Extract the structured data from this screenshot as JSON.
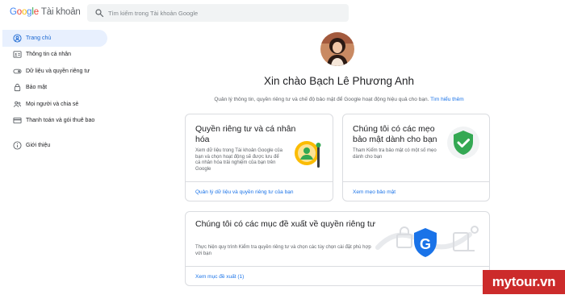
{
  "header": {
    "logo_word": "Google",
    "logo_suffix": "Tài khoản",
    "search_placeholder": "Tìm kiếm trong Tài khoản Google"
  },
  "sidebar": {
    "items": [
      {
        "label": "Trang chủ",
        "icon": "person-circle-icon",
        "active": true
      },
      {
        "label": "Thông tin cá nhân",
        "icon": "id-card-icon"
      },
      {
        "label": "Dữ liệu và quyền riêng tư",
        "icon": "toggle-icon"
      },
      {
        "label": "Bảo mật",
        "icon": "lock-icon"
      },
      {
        "label": "Mọi người và chia sẻ",
        "icon": "people-icon"
      },
      {
        "label": "Thanh toán và gói thuê bao",
        "icon": "credit-card-icon"
      },
      {
        "label": "Giới thiệu",
        "icon": "info-icon"
      }
    ]
  },
  "main": {
    "greeting": "Xin chào Bạch Lê Phương Anh",
    "subtitle": "Quản lý thông tin, quyền riêng tư và chế độ bảo mật để Google hoạt động hiệu quả cho bạn.",
    "learn_more": "Tìm hiểu thêm",
    "cards": [
      {
        "title": "Quyền riêng tư và cá nhân hóa",
        "desc": "Xem dữ liệu trong Tài khoản Google của bạn và chọn hoạt động sẽ được lưu để cá nhân hóa trải nghiệm của bạn trên Google",
        "link": "Quản lý dữ liệu và quyền riêng tư của bạn"
      },
      {
        "title": "Chúng tôi có các mẹo bảo mật dành cho bạn",
        "desc": "Tham Kiểm tra bảo mật có một số mẹo dành cho bạn",
        "link": "Xem mẹo bảo mật"
      },
      {
        "title": "Chúng tôi có các mục đề xuất về quyền riêng tư",
        "desc": "Thực hiện quy trình Kiểm tra quyền riêng tư và chọn các tùy chọn cài đặt phù hợp với bạn",
        "link": "Xem mục đề xuất (1)"
      }
    ]
  },
  "watermark": "mytour.vn",
  "colors": {
    "accent": "#1a73e8",
    "active_bg": "#e8f0fe",
    "shield": "#34a853",
    "watermark_bg": "#cc2b2b"
  }
}
